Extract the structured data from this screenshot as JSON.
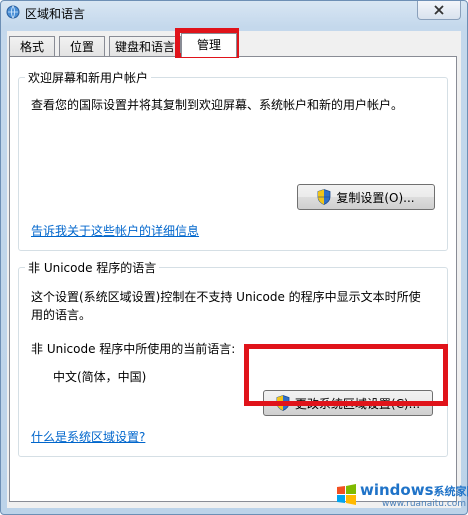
{
  "window": {
    "title": "区域和语言",
    "close_label": "✕"
  },
  "tabs": [
    {
      "label": "格式"
    },
    {
      "label": "位置"
    },
    {
      "label": "键盘和语言"
    },
    {
      "label": "管理",
      "active": true
    }
  ],
  "welcome": {
    "group_title": "欢迎屏幕和新用户帐户",
    "description": "查看您的国际设置并将其复制到欢迎屏幕、系统帐户和新的用户帐户。",
    "copy_button": "复制设置(O)...",
    "link": "告诉我关于这些帐户的详细信息"
  },
  "unicode": {
    "group_title": "非 Unicode 程序的语言",
    "description_line1": "这个设置(系统区域设置)控制在不支持 Unicode 的程序中显示文本时所使",
    "description_line2": "用的语言。",
    "current_label": "非 Unicode 程序中所使用的当前语言:",
    "current_value": "中文(简体，中国)",
    "change_button": "更改系统区域设置(C)...",
    "link": "什么是系统区域设置?"
  },
  "watermark": {
    "brand": "windows",
    "brand_suffix": "系统家园",
    "url": "www.ruanaitu.com"
  },
  "colors": {
    "highlight": "#e0131a",
    "link": "#0066cc"
  }
}
